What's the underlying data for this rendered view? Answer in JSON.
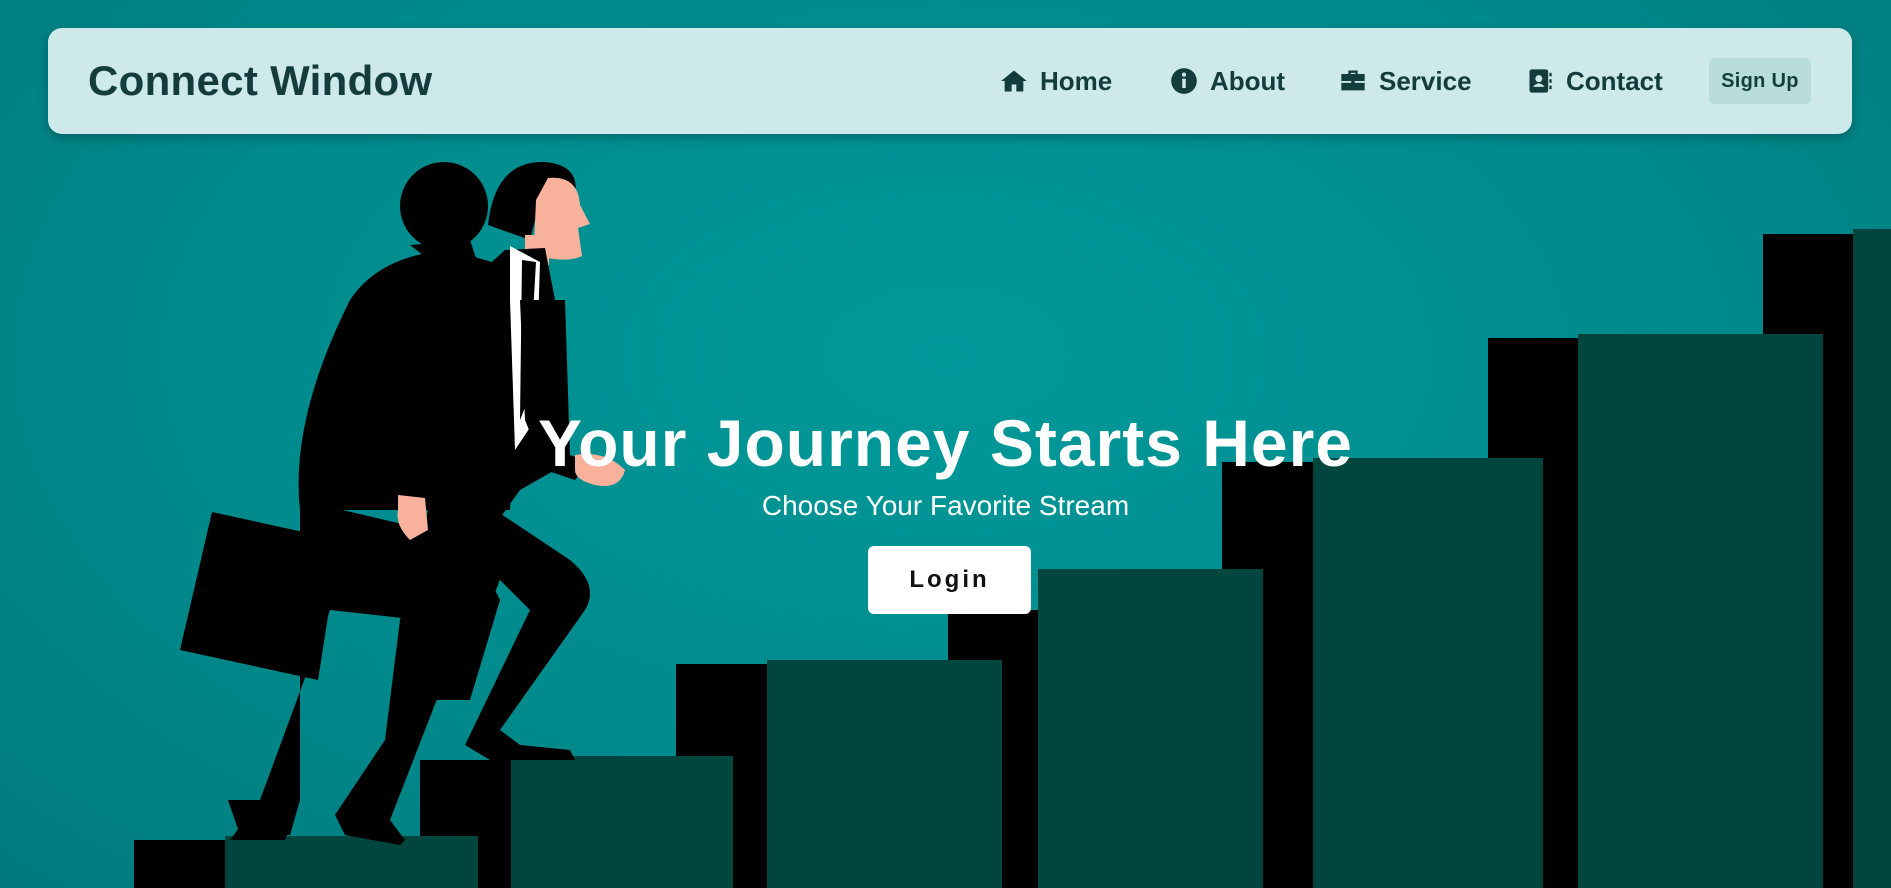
{
  "brand": {
    "title": "Connect Window"
  },
  "nav": {
    "items": [
      {
        "label": "Home",
        "icon": "home-icon"
      },
      {
        "label": "About",
        "icon": "info-icon"
      },
      {
        "label": "Service",
        "icon": "briefcase-icon"
      },
      {
        "label": "Contact",
        "icon": "contact-book-icon"
      }
    ],
    "signup_label": "Sign Up"
  },
  "hero": {
    "title": "Your Journey Starts Here",
    "subtitle": "Choose Your Favorite Stream",
    "login_label": "Login"
  },
  "colors": {
    "background": "#00999a",
    "navbar": "#cde9e9",
    "nav_text": "#143c3c",
    "step_dark": "#00463f",
    "step_shadow": "#000000",
    "skin": "#f8b29c"
  }
}
